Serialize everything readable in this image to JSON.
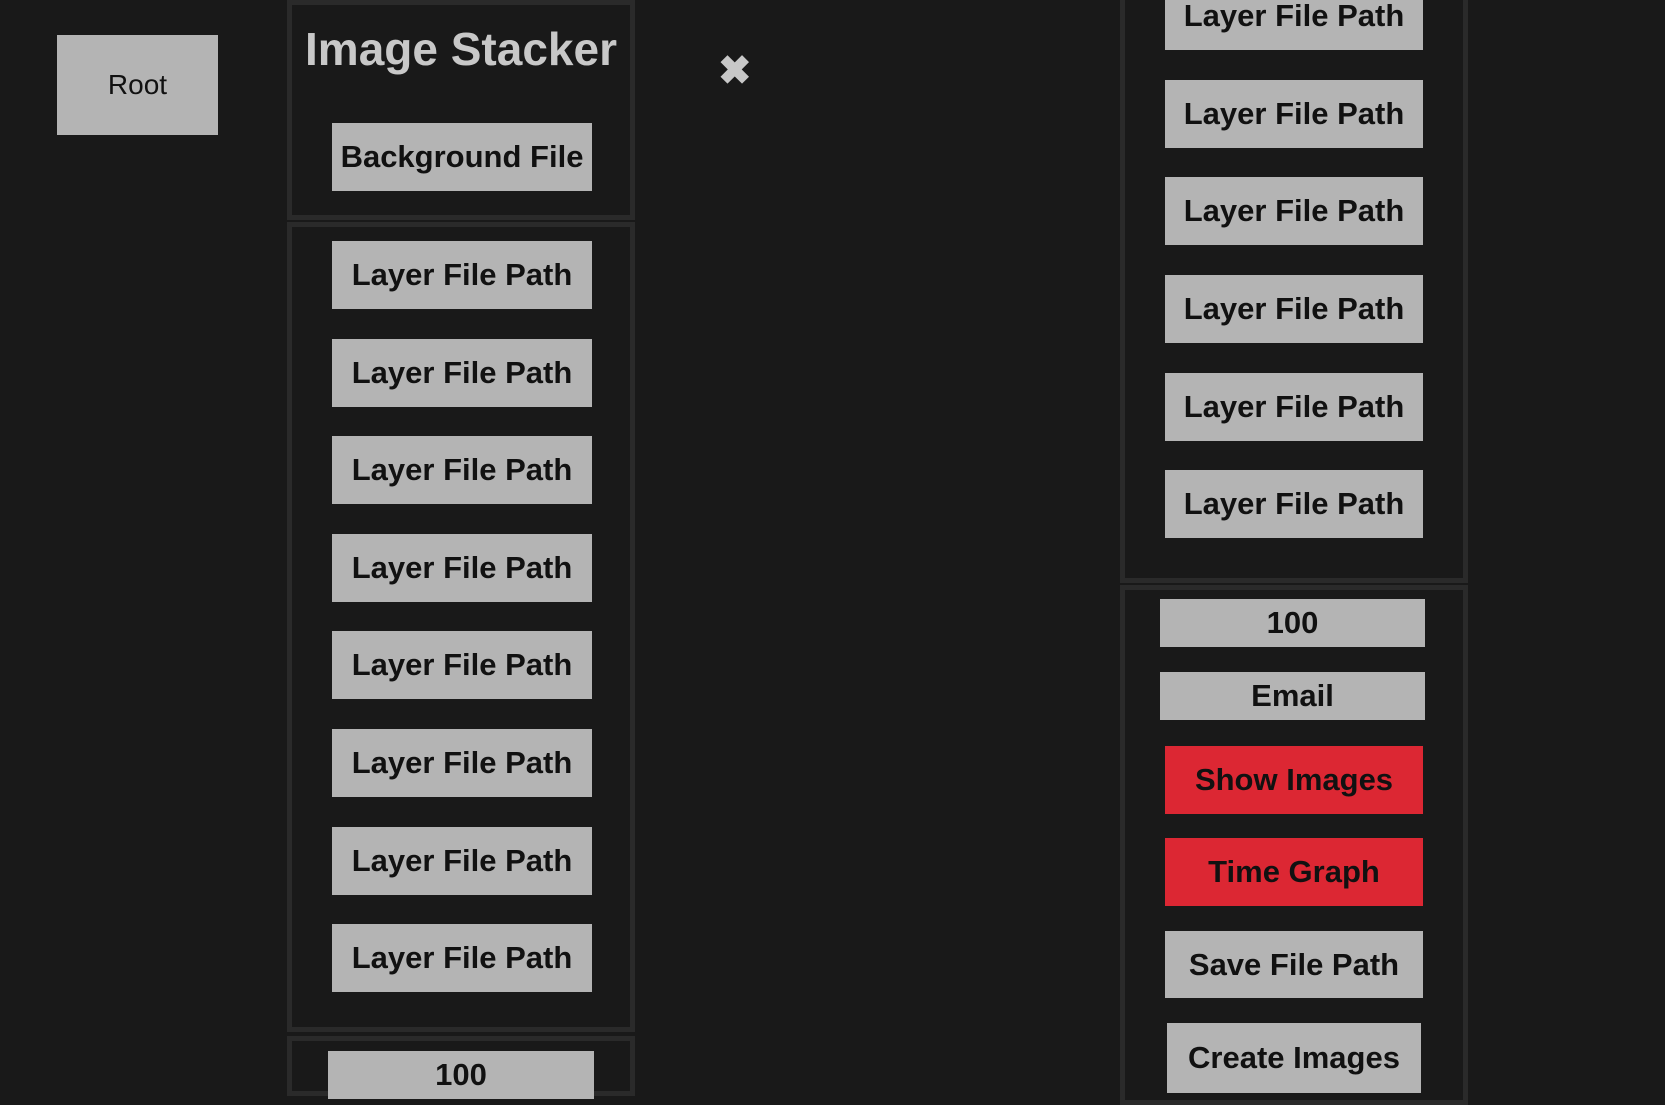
{
  "nav": {
    "root_label": "Root"
  },
  "left_panel": {
    "title": "Image Stacker",
    "background_label": "Background File",
    "layers": [
      "Layer File Path",
      "Layer File Path",
      "Layer File Path",
      "Layer File Path",
      "Layer File Path",
      "Layer File Path",
      "Layer File Path",
      "Layer File Path"
    ],
    "value_field": "100"
  },
  "close_icon": "✖",
  "right_panel": {
    "layers": [
      "Layer File Path",
      "Layer File Path",
      "Layer File Path",
      "Layer File Path",
      "Layer File Path",
      "Layer File Path"
    ],
    "value_field": "100",
    "email_field": "Email",
    "show_images_label": "Show Images",
    "time_graph_label": "Time Graph",
    "save_path_label": "Save File Path",
    "create_images_label": "Create Images"
  },
  "colors": {
    "background": "#191919",
    "button": "#b4b4b4",
    "accent_red": "#dc2733",
    "panel_border": "#2a2a2a"
  }
}
